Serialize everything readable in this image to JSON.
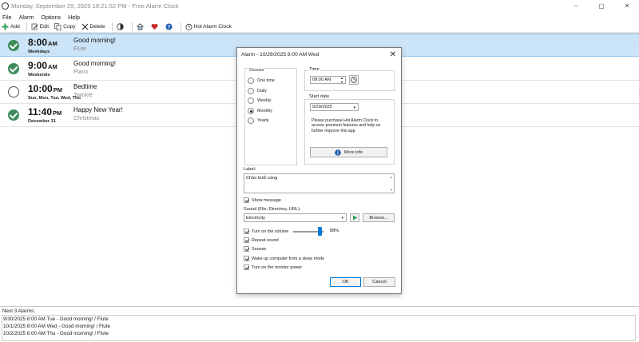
{
  "window": {
    "title": "Monday, September 29, 2025 10:21:52 PM - Free Alarm Clock",
    "controls": [
      "–",
      "▢",
      "✕"
    ]
  },
  "menu": [
    "File",
    "Alarm",
    "Options",
    "Help"
  ],
  "toolbar": {
    "add": "Add",
    "edit": "Edit",
    "copy": "Copy",
    "delete": "Delete",
    "hot_alarm": "Hot Alarm Clock"
  },
  "alarms": [
    {
      "enabled": true,
      "time": "8:00",
      "ampm": "AM",
      "days": "Weekdays",
      "name": "Good morning!",
      "sound": "Flute",
      "selected": true
    },
    {
      "enabled": true,
      "time": "9:00",
      "ampm": "AM",
      "days": "Weekends",
      "name": "Good morning!",
      "sound": "Piano",
      "selected": false
    },
    {
      "enabled": false,
      "time": "10:00",
      "ampm": "PM",
      "days": "Sun, Mon, Tue, Wed, Thu",
      "name": "Bedtime",
      "sound": "Twinkle",
      "selected": false
    },
    {
      "enabled": true,
      "time": "11:40",
      "ampm": "PM",
      "days": "December 31",
      "name": "Happy New Year!",
      "sound": "Christmas",
      "selected": false
    }
  ],
  "next_alarms": {
    "title": "Next 3 Alarms:",
    "items": [
      "9/30/2025 8:00 AM Tue - Good morning! / Flute",
      "10/1/2025 8:00 AM Wed - Good morning! / Flute",
      "10/2/2025 8:00 AM Thu - Good morning! / Flute"
    ]
  },
  "dialog": {
    "title": "Alarm - 10/29/2025 8:00 AM Wed",
    "close": "✕",
    "occurs_title": "Occurs",
    "occurs": [
      {
        "label": "One time",
        "selected": false
      },
      {
        "label": "Daily",
        "selected": false
      },
      {
        "label": "Weekly",
        "selected": false
      },
      {
        "label": "Monthly",
        "selected": true
      },
      {
        "label": "Yearly",
        "selected": false
      }
    ],
    "time_title": "Time",
    "time_value": "08:00 AM",
    "start_date_title": "Start date",
    "start_date_value": "9/29/2025",
    "purchase_text": "Please purchase Hot Alarm Clock to access premium features and help us further improve this app.",
    "more_info": "More info",
    "label_title": "Label:",
    "label_value": "Chào buổi sáng",
    "show_message": "Show message",
    "show_message_checked": true,
    "sound_title": "Sound (File, Directory, URL):",
    "sound_value": "Electricity",
    "browse": "Browse...",
    "volume_label": "Turn on the volume",
    "volume_checked": true,
    "volume_percent": "88%",
    "volume_level": 0.88,
    "options": [
      {
        "label": "Repeat sound",
        "checked": true
      },
      {
        "label": "Snooze",
        "checked": true
      },
      {
        "label": "Wake up computer from a sleep mode",
        "checked": true
      },
      {
        "label": "Turn on the monitor power",
        "checked": true
      }
    ],
    "ok": "OK",
    "cancel": "Cancel"
  },
  "colors": {
    "selection": "#cce4f7",
    "check_green": "#3d8c5a",
    "accent_blue": "#0078d7",
    "play_green": "#2e9e5b"
  }
}
